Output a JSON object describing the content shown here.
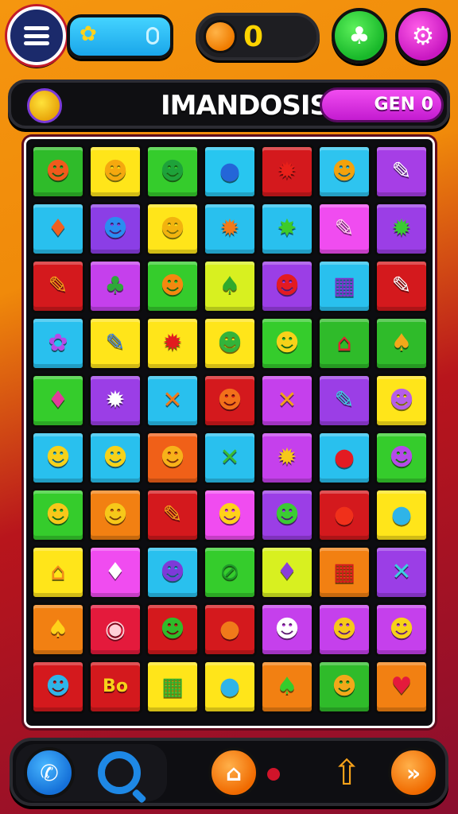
{
  "header": {
    "menu_icon": "hamburger-icon",
    "coins": "0",
    "buttons": [
      {
        "name": "creature-button",
        "icon": "monster-icon"
      },
      {
        "name": "settings-button",
        "icon": "gear-eye-icon"
      }
    ]
  },
  "titlebar": {
    "title": "IMANDOSIS",
    "gen_label": "GEN 0"
  },
  "board": {
    "tiles": [
      {
        "bg": "#2fbb2a",
        "glyph": "☻",
        "fg": "#f05a1c"
      },
      {
        "bg": "#ffe51a",
        "glyph": "☻",
        "fg": "#f5a80f"
      },
      {
        "bg": "#35cc2c",
        "glyph": "☻",
        "fg": "#1ea23a"
      },
      {
        "bg": "#28c6f0",
        "glyph": "●",
        "fg": "#2466d8"
      },
      {
        "bg": "#d4191d",
        "glyph": "✹",
        "fg": "#e8201a"
      },
      {
        "bg": "#2ec4ef",
        "glyph": "☻",
        "fg": "#f2a20d"
      },
      {
        "bg": "#a63ee6",
        "glyph": "✎",
        "fg": "#ffffff"
      },
      {
        "bg": "#29c0ee",
        "glyph": "♦",
        "fg": "#f06020"
      },
      {
        "bg": "#8b3ee6",
        "glyph": "☻",
        "fg": "#2a8df0"
      },
      {
        "bg": "#ffe51a",
        "glyph": "☻",
        "fg": "#f2b30f"
      },
      {
        "bg": "#29c0ee",
        "glyph": "✹",
        "fg": "#f27a1a"
      },
      {
        "bg": "#29c0ee",
        "glyph": "✸",
        "fg": "#3ecb2a"
      },
      {
        "bg": "#f04cf0",
        "glyph": "✎",
        "fg": "#ffd0ef"
      },
      {
        "bg": "#9b3ee6",
        "glyph": "✹",
        "fg": "#3bcb33"
      },
      {
        "bg": "#d4191d",
        "glyph": "✎",
        "fg": "#f4a21a"
      },
      {
        "bg": "#c540ec",
        "glyph": "♣",
        "fg": "#2ea83a"
      },
      {
        "bg": "#35cc2c",
        "glyph": "☻",
        "fg": "#f4880f"
      },
      {
        "bg": "#d8f020",
        "glyph": "♠",
        "fg": "#2faa2c"
      },
      {
        "bg": "#9b3ee6",
        "glyph": "☻",
        "fg": "#e31b22"
      },
      {
        "bg": "#29c0ee",
        "glyph": "▦",
        "fg": "#7f2ec8"
      },
      {
        "bg": "#d4191d",
        "glyph": "✎",
        "fg": "#ffffff"
      },
      {
        "bg": "#29c0ee",
        "glyph": "✿",
        "fg": "#b54ae8"
      },
      {
        "bg": "#ffe51a",
        "glyph": "✎",
        "fg": "#3a7de0"
      },
      {
        "bg": "#ffe51a",
        "glyph": "✹",
        "fg": "#e31b1f"
      },
      {
        "bg": "#ffe51a",
        "glyph": "☻",
        "fg": "#33b33a"
      },
      {
        "bg": "#35cc2c",
        "glyph": "☻",
        "fg": "#f6d21a"
      },
      {
        "bg": "#2fbb2a",
        "glyph": "⌂",
        "fg": "#e02430"
      },
      {
        "bg": "#2fbb2a",
        "glyph": "♠",
        "fg": "#f2a81a"
      },
      {
        "bg": "#35cc2c",
        "glyph": "♦",
        "fg": "#e03b9a"
      },
      {
        "bg": "#9b3ee6",
        "glyph": "✹",
        "fg": "#ffffff"
      },
      {
        "bg": "#29c0ee",
        "glyph": "✕",
        "fg": "#f07a1a"
      },
      {
        "bg": "#d4191d",
        "glyph": "☻",
        "fg": "#f2701a"
      },
      {
        "bg": "#c540ec",
        "glyph": "✕",
        "fg": "#f2a01a"
      },
      {
        "bg": "#9b3ee6",
        "glyph": "✎",
        "fg": "#3bd0e0"
      },
      {
        "bg": "#ffe51a",
        "glyph": "☻",
        "fg": "#b65ee8"
      },
      {
        "bg": "#29c0ee",
        "glyph": "☻",
        "fg": "#f6d21a"
      },
      {
        "bg": "#29c0ee",
        "glyph": "☻",
        "fg": "#f6d21a"
      },
      {
        "bg": "#f06018",
        "glyph": "☻",
        "fg": "#f7b21a"
      },
      {
        "bg": "#29c0ee",
        "glyph": "✕",
        "fg": "#3bbb33"
      },
      {
        "bg": "#c540ec",
        "glyph": "✹",
        "fg": "#f6c81a"
      },
      {
        "bg": "#29c0ee",
        "glyph": "●",
        "fg": "#e31b22"
      },
      {
        "bg": "#35cc2c",
        "glyph": "☻",
        "fg": "#b54ae8"
      },
      {
        "bg": "#35cc2c",
        "glyph": "☻",
        "fg": "#f6c81a"
      },
      {
        "bg": "#f28012",
        "glyph": "☻",
        "fg": "#f6c81a"
      },
      {
        "bg": "#d4191d",
        "glyph": "✎",
        "fg": "#f4a21a"
      },
      {
        "bg": "#f04cf0",
        "glyph": "☻",
        "fg": "#ffd21a"
      },
      {
        "bg": "#9b3ee6",
        "glyph": "☻",
        "fg": "#3bcb33"
      },
      {
        "bg": "#d4191d",
        "glyph": "●",
        "fg": "#f0301a"
      },
      {
        "bg": "#ffe51a",
        "glyph": "●",
        "fg": "#2fb4e8"
      },
      {
        "bg": "#ffe51a",
        "glyph": "⌂",
        "fg": "#f28a1a"
      },
      {
        "bg": "#f04cf0",
        "glyph": "♦",
        "fg": "#ffffff"
      },
      {
        "bg": "#29c0ee",
        "glyph": "☻",
        "fg": "#7d3ad8"
      },
      {
        "bg": "#35cc2c",
        "glyph": "⊘",
        "fg": "#1f9a2a"
      },
      {
        "bg": "#d8f020",
        "glyph": "♦",
        "fg": "#8a3ed8"
      },
      {
        "bg": "#f28012",
        "glyph": "▦",
        "fg": "#d4191d"
      },
      {
        "bg": "#9b3ee6",
        "glyph": "✕",
        "fg": "#3bd0e0"
      },
      {
        "bg": "#f28012",
        "glyph": "♠",
        "fg": "#ffd21a"
      },
      {
        "bg": "#e41a3c",
        "glyph": "◉",
        "fg": "#ffd0d8"
      },
      {
        "bg": "#d4191d",
        "glyph": "☻",
        "fg": "#2fbb2a"
      },
      {
        "bg": "#d4191d",
        "glyph": "●",
        "fg": "#f07a1a"
      },
      {
        "bg": "#c540ec",
        "glyph": "☻",
        "fg": "#ffffff"
      },
      {
        "bg": "#c540ec",
        "glyph": "☻",
        "fg": "#f6c81a"
      },
      {
        "bg": "#c540ec",
        "glyph": "☻",
        "fg": "#f6d21a"
      },
      {
        "bg": "#d4191d",
        "glyph": "☻",
        "fg": "#2fb4e8"
      },
      {
        "bg": "#d4191d",
        "glyph": "Bo",
        "fg": "#f6d21a"
      },
      {
        "bg": "#ffe51a",
        "glyph": "▦",
        "fg": "#2faa2c"
      },
      {
        "bg": "#ffe51a",
        "glyph": "●",
        "fg": "#2fb4e8"
      },
      {
        "bg": "#f28012",
        "glyph": "♠",
        "fg": "#35cc2c"
      },
      {
        "bg": "#2fbb2a",
        "glyph": "☻",
        "fg": "#f2a81a"
      },
      {
        "bg": "#f28012",
        "glyph": "♥",
        "fg": "#e41a3c"
      }
    ]
  },
  "footer": {
    "buttons": [
      {
        "name": "phone-button",
        "icon": "phone-icon"
      },
      {
        "name": "search-button",
        "icon": "search-icon"
      },
      {
        "name": "home-button",
        "icon": "home-icon"
      },
      {
        "name": "up-arrow-button",
        "icon": "up-arrow-icon"
      },
      {
        "name": "fast-forward-button",
        "icon": "fast-forward-icon"
      }
    ]
  }
}
